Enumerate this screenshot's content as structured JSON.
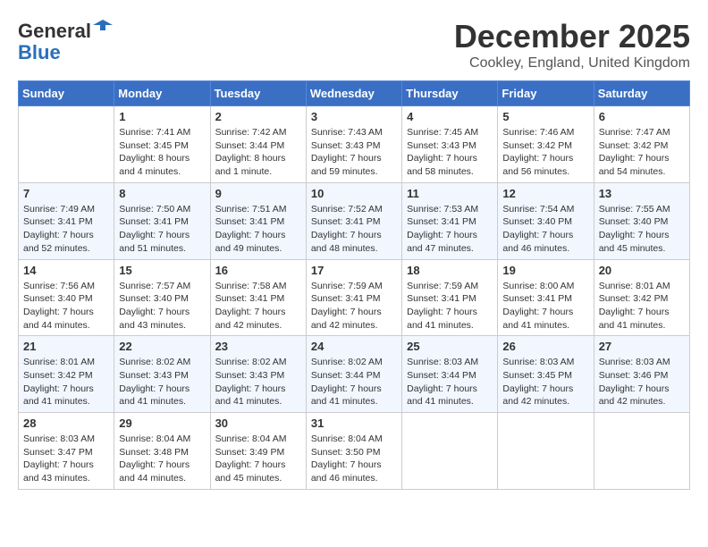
{
  "header": {
    "logo_line1": "General",
    "logo_line2": "Blue",
    "month_title": "December 2025",
    "location": "Cookley, England, United Kingdom"
  },
  "columns": [
    "Sunday",
    "Monday",
    "Tuesday",
    "Wednesday",
    "Thursday",
    "Friday",
    "Saturday"
  ],
  "weeks": [
    [
      {
        "day": "",
        "sunrise": "",
        "sunset": "",
        "daylight": ""
      },
      {
        "day": "1",
        "sunrise": "Sunrise: 7:41 AM",
        "sunset": "Sunset: 3:45 PM",
        "daylight": "Daylight: 8 hours and 4 minutes."
      },
      {
        "day": "2",
        "sunrise": "Sunrise: 7:42 AM",
        "sunset": "Sunset: 3:44 PM",
        "daylight": "Daylight: 8 hours and 1 minute."
      },
      {
        "day": "3",
        "sunrise": "Sunrise: 7:43 AM",
        "sunset": "Sunset: 3:43 PM",
        "daylight": "Daylight: 7 hours and 59 minutes."
      },
      {
        "day": "4",
        "sunrise": "Sunrise: 7:45 AM",
        "sunset": "Sunset: 3:43 PM",
        "daylight": "Daylight: 7 hours and 58 minutes."
      },
      {
        "day": "5",
        "sunrise": "Sunrise: 7:46 AM",
        "sunset": "Sunset: 3:42 PM",
        "daylight": "Daylight: 7 hours and 56 minutes."
      },
      {
        "day": "6",
        "sunrise": "Sunrise: 7:47 AM",
        "sunset": "Sunset: 3:42 PM",
        "daylight": "Daylight: 7 hours and 54 minutes."
      }
    ],
    [
      {
        "day": "7",
        "sunrise": "Sunrise: 7:49 AM",
        "sunset": "Sunset: 3:41 PM",
        "daylight": "Daylight: 7 hours and 52 minutes."
      },
      {
        "day": "8",
        "sunrise": "Sunrise: 7:50 AM",
        "sunset": "Sunset: 3:41 PM",
        "daylight": "Daylight: 7 hours and 51 minutes."
      },
      {
        "day": "9",
        "sunrise": "Sunrise: 7:51 AM",
        "sunset": "Sunset: 3:41 PM",
        "daylight": "Daylight: 7 hours and 49 minutes."
      },
      {
        "day": "10",
        "sunrise": "Sunrise: 7:52 AM",
        "sunset": "Sunset: 3:41 PM",
        "daylight": "Daylight: 7 hours and 48 minutes."
      },
      {
        "day": "11",
        "sunrise": "Sunrise: 7:53 AM",
        "sunset": "Sunset: 3:41 PM",
        "daylight": "Daylight: 7 hours and 47 minutes."
      },
      {
        "day": "12",
        "sunrise": "Sunrise: 7:54 AM",
        "sunset": "Sunset: 3:40 PM",
        "daylight": "Daylight: 7 hours and 46 minutes."
      },
      {
        "day": "13",
        "sunrise": "Sunrise: 7:55 AM",
        "sunset": "Sunset: 3:40 PM",
        "daylight": "Daylight: 7 hours and 45 minutes."
      }
    ],
    [
      {
        "day": "14",
        "sunrise": "Sunrise: 7:56 AM",
        "sunset": "Sunset: 3:40 PM",
        "daylight": "Daylight: 7 hours and 44 minutes."
      },
      {
        "day": "15",
        "sunrise": "Sunrise: 7:57 AM",
        "sunset": "Sunset: 3:40 PM",
        "daylight": "Daylight: 7 hours and 43 minutes."
      },
      {
        "day": "16",
        "sunrise": "Sunrise: 7:58 AM",
        "sunset": "Sunset: 3:41 PM",
        "daylight": "Daylight: 7 hours and 42 minutes."
      },
      {
        "day": "17",
        "sunrise": "Sunrise: 7:59 AM",
        "sunset": "Sunset: 3:41 PM",
        "daylight": "Daylight: 7 hours and 42 minutes."
      },
      {
        "day": "18",
        "sunrise": "Sunrise: 7:59 AM",
        "sunset": "Sunset: 3:41 PM",
        "daylight": "Daylight: 7 hours and 41 minutes."
      },
      {
        "day": "19",
        "sunrise": "Sunrise: 8:00 AM",
        "sunset": "Sunset: 3:41 PM",
        "daylight": "Daylight: 7 hours and 41 minutes."
      },
      {
        "day": "20",
        "sunrise": "Sunrise: 8:01 AM",
        "sunset": "Sunset: 3:42 PM",
        "daylight": "Daylight: 7 hours and 41 minutes."
      }
    ],
    [
      {
        "day": "21",
        "sunrise": "Sunrise: 8:01 AM",
        "sunset": "Sunset: 3:42 PM",
        "daylight": "Daylight: 7 hours and 41 minutes."
      },
      {
        "day": "22",
        "sunrise": "Sunrise: 8:02 AM",
        "sunset": "Sunset: 3:43 PM",
        "daylight": "Daylight: 7 hours and 41 minutes."
      },
      {
        "day": "23",
        "sunrise": "Sunrise: 8:02 AM",
        "sunset": "Sunset: 3:43 PM",
        "daylight": "Daylight: 7 hours and 41 minutes."
      },
      {
        "day": "24",
        "sunrise": "Sunrise: 8:02 AM",
        "sunset": "Sunset: 3:44 PM",
        "daylight": "Daylight: 7 hours and 41 minutes."
      },
      {
        "day": "25",
        "sunrise": "Sunrise: 8:03 AM",
        "sunset": "Sunset: 3:44 PM",
        "daylight": "Daylight: 7 hours and 41 minutes."
      },
      {
        "day": "26",
        "sunrise": "Sunrise: 8:03 AM",
        "sunset": "Sunset: 3:45 PM",
        "daylight": "Daylight: 7 hours and 42 minutes."
      },
      {
        "day": "27",
        "sunrise": "Sunrise: 8:03 AM",
        "sunset": "Sunset: 3:46 PM",
        "daylight": "Daylight: 7 hours and 42 minutes."
      }
    ],
    [
      {
        "day": "28",
        "sunrise": "Sunrise: 8:03 AM",
        "sunset": "Sunset: 3:47 PM",
        "daylight": "Daylight: 7 hours and 43 minutes."
      },
      {
        "day": "29",
        "sunrise": "Sunrise: 8:04 AM",
        "sunset": "Sunset: 3:48 PM",
        "daylight": "Daylight: 7 hours and 44 minutes."
      },
      {
        "day": "30",
        "sunrise": "Sunrise: 8:04 AM",
        "sunset": "Sunset: 3:49 PM",
        "daylight": "Daylight: 7 hours and 45 minutes."
      },
      {
        "day": "31",
        "sunrise": "Sunrise: 8:04 AM",
        "sunset": "Sunset: 3:50 PM",
        "daylight": "Daylight: 7 hours and 46 minutes."
      },
      {
        "day": "",
        "sunrise": "",
        "sunset": "",
        "daylight": ""
      },
      {
        "day": "",
        "sunrise": "",
        "sunset": "",
        "daylight": ""
      },
      {
        "day": "",
        "sunrise": "",
        "sunset": "",
        "daylight": ""
      }
    ]
  ]
}
